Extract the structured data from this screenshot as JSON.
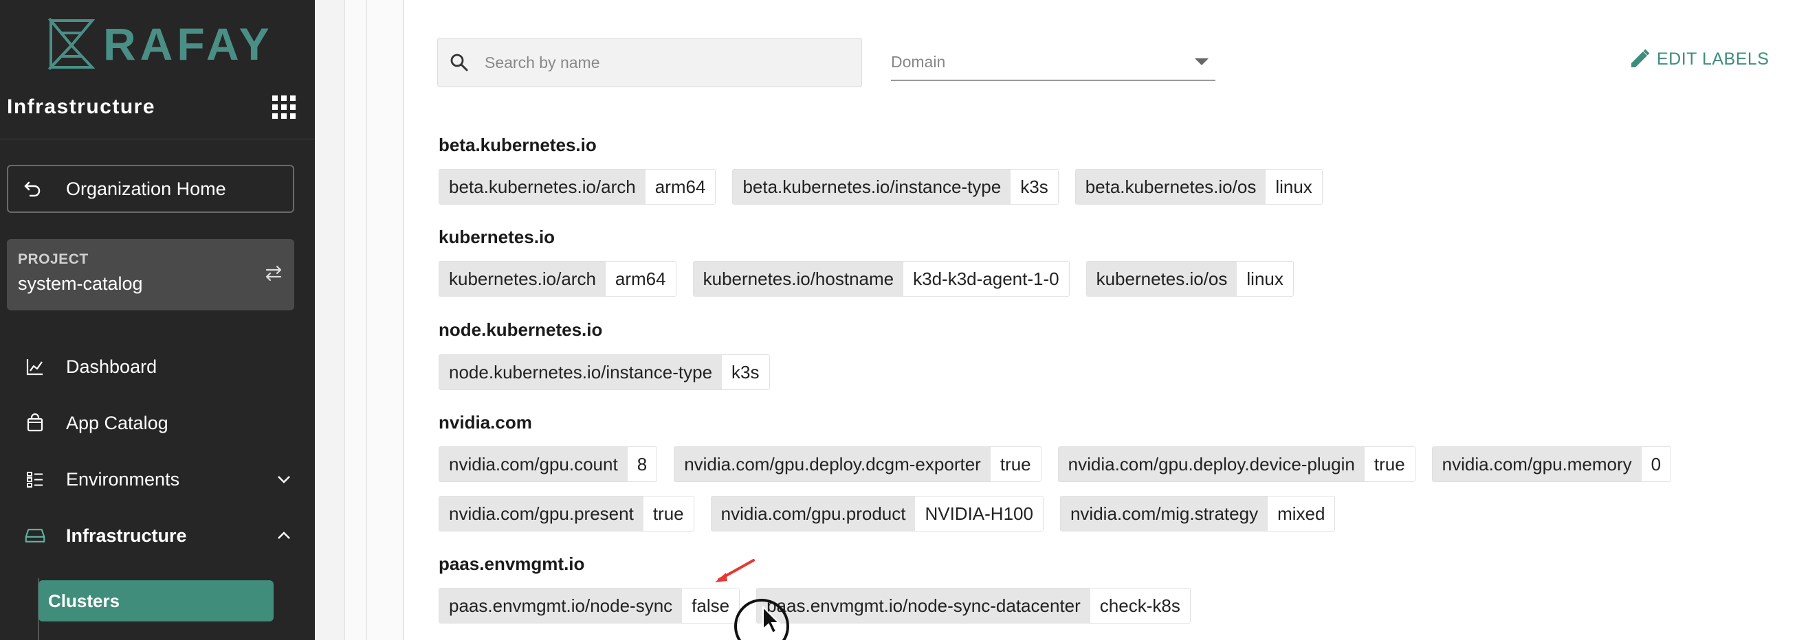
{
  "brand": {
    "logo_text": "RAFAY"
  },
  "sidebar": {
    "title": "Infrastructure",
    "org_home": "Organization Home",
    "project": {
      "label": "PROJECT",
      "name": "system-catalog"
    },
    "nav": [
      {
        "label": "Dashboard"
      },
      {
        "label": "App Catalog"
      },
      {
        "label": "Environments"
      },
      {
        "label": "Infrastructure"
      }
    ],
    "sub_active": "Clusters"
  },
  "toolbar": {
    "search_placeholder": "Search by name",
    "domain_label": "Domain",
    "edit_labels": "EDIT LABELS"
  },
  "groups": [
    {
      "title": "beta.kubernetes.io",
      "rows": [
        [
          {
            "key": "beta.kubernetes.io/arch",
            "value": "arm64"
          },
          {
            "key": "beta.kubernetes.io/instance-type",
            "value": "k3s"
          },
          {
            "key": "beta.kubernetes.io/os",
            "value": "linux"
          }
        ]
      ]
    },
    {
      "title": "kubernetes.io",
      "rows": [
        [
          {
            "key": "kubernetes.io/arch",
            "value": "arm64"
          },
          {
            "key": "kubernetes.io/hostname",
            "value": "k3d-k3d-agent-1-0"
          },
          {
            "key": "kubernetes.io/os",
            "value": "linux"
          }
        ]
      ]
    },
    {
      "title": "node.kubernetes.io",
      "rows": [
        [
          {
            "key": "node.kubernetes.io/instance-type",
            "value": "k3s"
          }
        ]
      ]
    },
    {
      "title": "nvidia.com",
      "rows": [
        [
          {
            "key": "nvidia.com/gpu.count",
            "value": "8"
          },
          {
            "key": "nvidia.com/gpu.deploy.dcgm-exporter",
            "value": "true"
          },
          {
            "key": "nvidia.com/gpu.deploy.device-plugin",
            "value": "true"
          },
          {
            "key": "nvidia.com/gpu.memory",
            "value": "0"
          }
        ],
        [
          {
            "key": "nvidia.com/gpu.present",
            "value": "true"
          },
          {
            "key": "nvidia.com/gpu.product",
            "value": "NVIDIA-H100"
          },
          {
            "key": "nvidia.com/mig.strategy",
            "value": "mixed"
          }
        ]
      ]
    },
    {
      "title": "paas.envmgmt.io",
      "rows": [
        [
          {
            "key": "paas.envmgmt.io/node-sync",
            "value": "false"
          },
          {
            "key": "paas.envmgmt.io/node-sync-datacenter",
            "value": "check-k8s"
          }
        ]
      ]
    }
  ],
  "colors": {
    "sidebar_bg": "#262626",
    "accent": "#3f8d7a",
    "annotation": "#e53935"
  }
}
